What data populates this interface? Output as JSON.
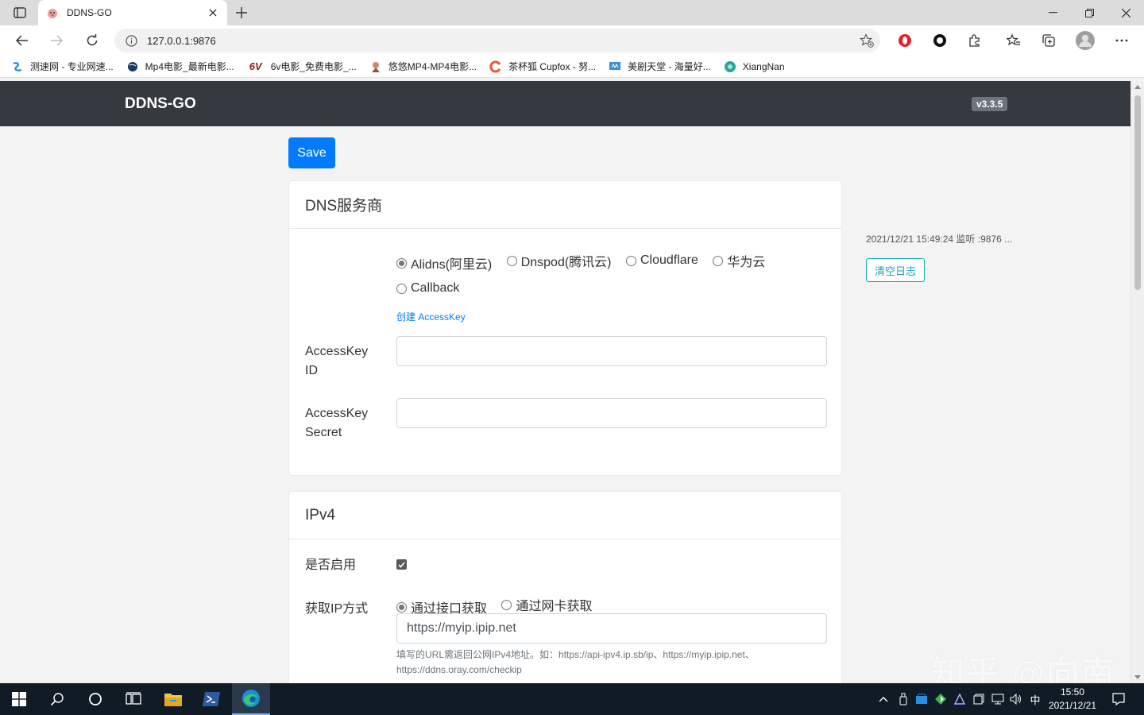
{
  "browser": {
    "tab_title": "DDNS-GO",
    "url": "127.0.0.1:9876",
    "bookmarks": [
      {
        "label": "测速网 - 专业网速..."
      },
      {
        "label": "Mp4电影_最新电影..."
      },
      {
        "label": "6v电影_免费电影_..."
      },
      {
        "label": "悠悠MP4-MP4电影..."
      },
      {
        "label": "茶杯狐 Cupfox - 努..."
      },
      {
        "label": "美剧天堂 - 海量好..."
      },
      {
        "label": "XiangNan"
      }
    ]
  },
  "app": {
    "brand": "DDNS-GO",
    "version": "v3.3.5",
    "save_label": "Save"
  },
  "dns_card": {
    "title": "DNS服务商",
    "providers": [
      {
        "label": "Alidns(阿里云)",
        "selected": true
      },
      {
        "label": "Dnspod(腾讯云)",
        "selected": false
      },
      {
        "label": "Cloudflare",
        "selected": false
      },
      {
        "label": "华为云",
        "selected": false
      },
      {
        "label": "Callback",
        "selected": false
      }
    ],
    "create_key_link": "创建 AccessKey",
    "id_label_1": "AccessKey",
    "id_label_2": "ID",
    "id_value": "",
    "secret_label_1": "AccessKey",
    "secret_label_2": "Secret",
    "secret_value": ""
  },
  "ipv4_card": {
    "title": "IPv4",
    "enable_label": "是否启用",
    "enabled": true,
    "method_label": "获取IP方式",
    "methods": [
      {
        "label": "通过接口获取",
        "selected": true
      },
      {
        "label": "通过网卡获取",
        "selected": false
      }
    ],
    "url_value": "https://myip.ipip.net",
    "help_line_1": "填写的URL需返回公网IPv4地址。如：https://api-ipv4.ip.sb/ip、https://myip.ipip.net、",
    "help_line_2": "https://ddns.oray.com/checkip"
  },
  "log": {
    "line": "2021/12/21 15:49:24 监听 :9876 ...",
    "clear_label": "清空日志"
  },
  "watermark": "知乎 @向南",
  "taskbar": {
    "ime": "中",
    "time": "15:50",
    "date": "2021/12/21"
  }
}
